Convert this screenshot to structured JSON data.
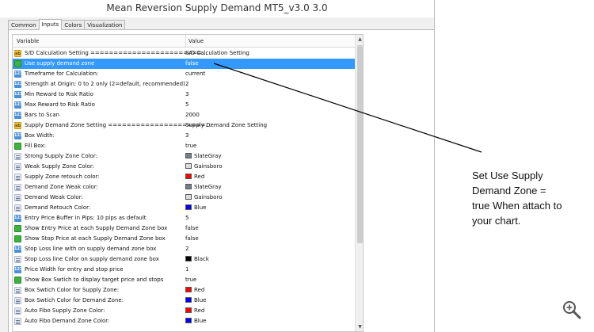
{
  "window": {
    "title": "Mean Reversion Supply Demand MT5_v3.0 3.0"
  },
  "tabs": [
    {
      "label": "Common",
      "active": false
    },
    {
      "label": "Inputs",
      "active": true
    },
    {
      "label": "Colors",
      "active": false
    },
    {
      "label": "Visualization",
      "active": false
    }
  ],
  "grid": {
    "headers": {
      "variable": "Variable",
      "value": "Value"
    },
    "rows": [
      {
        "icon": "ab-icon",
        "label": "S/D Calculation Setting ========================...",
        "value": "S/D Calculation Setting"
      },
      {
        "icon": "bool-icon",
        "label": "Use supply demand zone",
        "value": "false",
        "selected": true
      },
      {
        "icon": "int-icon",
        "label": "Timeframe for Calculation:",
        "value": "current"
      },
      {
        "icon": "int-icon",
        "label": "Strength at Origin: 0 to 2 only (2=default, recommended)",
        "value": "2"
      },
      {
        "icon": "int-icon",
        "label": "Min Reward to Risk Ratio",
        "value": "3"
      },
      {
        "icon": "int-icon",
        "label": "Max Reward to Risk Ratio",
        "value": "5"
      },
      {
        "icon": "int-icon",
        "label": "Bars to Scan",
        "value": "2000"
      },
      {
        "icon": "ab-icon",
        "label": "Supply Demand Zone Setting =====================...",
        "value": "Supply Demand Zone Setting"
      },
      {
        "icon": "int-icon",
        "label": "Box Width:",
        "value": "3"
      },
      {
        "icon": "bool-icon",
        "label": "Fill Box:",
        "value": "true"
      },
      {
        "icon": "str-icon",
        "label": "Strong Supply Zone Color:",
        "value": "SlateGray",
        "color": "#708090"
      },
      {
        "icon": "str-icon",
        "label": "Weak Supply Zone Color:",
        "value": "Gainsboro",
        "color": "#dcdcdc"
      },
      {
        "icon": "str-icon",
        "label": "Supply Zone retouch color:",
        "value": "Red",
        "color": "#ff0000"
      },
      {
        "icon": "str-icon",
        "label": "Demand Zone Weak color:",
        "value": "SlateGray",
        "color": "#708090"
      },
      {
        "icon": "str-icon",
        "label": "Demand Weak Color:",
        "value": "Gainsboro",
        "color": "#dcdcdc"
      },
      {
        "icon": "str-icon",
        "label": "Demand Retouch Color:",
        "value": "Blue",
        "color": "#0000ff"
      },
      {
        "icon": "int-icon",
        "label": "Entry Price Buffer in Pips: 10 pips as default",
        "value": "5"
      },
      {
        "icon": "bool-icon",
        "label": "Show Entry Price at each Supply Demand Zone box",
        "value": "false"
      },
      {
        "icon": "bool-icon",
        "label": "Show Stop Price at each Supply Demand Zone box",
        "value": "false"
      },
      {
        "icon": "int-icon",
        "label": "Stop Loss line with on supply demand zone box",
        "value": "2"
      },
      {
        "icon": "str-icon",
        "label": "Stop Loss line Color on supply demand zone box",
        "value": "Black",
        "color": "#000000"
      },
      {
        "icon": "int-icon",
        "label": "Price Width for entry and stop price",
        "value": "1"
      },
      {
        "icon": "bool-icon",
        "label": "Show Box Swtich to display target price and stops",
        "value": "true"
      },
      {
        "icon": "str-icon",
        "label": "Box Swtich Color for Supply Zone:",
        "value": "Red",
        "color": "#ff0000"
      },
      {
        "icon": "str-icon",
        "label": "Box Swtich Color for Demand Zone:",
        "value": "Blue",
        "color": "#0000ff"
      },
      {
        "icon": "str-icon",
        "label": "Auto Fibo Supply Zone Color:",
        "value": "Red",
        "color": "#ff0000"
      },
      {
        "icon": "str-icon",
        "label": "Auto Fibo Demand Zone Color:",
        "value": "Blue",
        "color": "#0000ff"
      }
    ]
  },
  "annotation": {
    "lines": [
      "Set Use Supply",
      "Demand Zone =",
      "true When attach to",
      "your chart."
    ]
  },
  "colors": {
    "selection": "#3399ff",
    "accent_blue": "#4a90d9"
  }
}
